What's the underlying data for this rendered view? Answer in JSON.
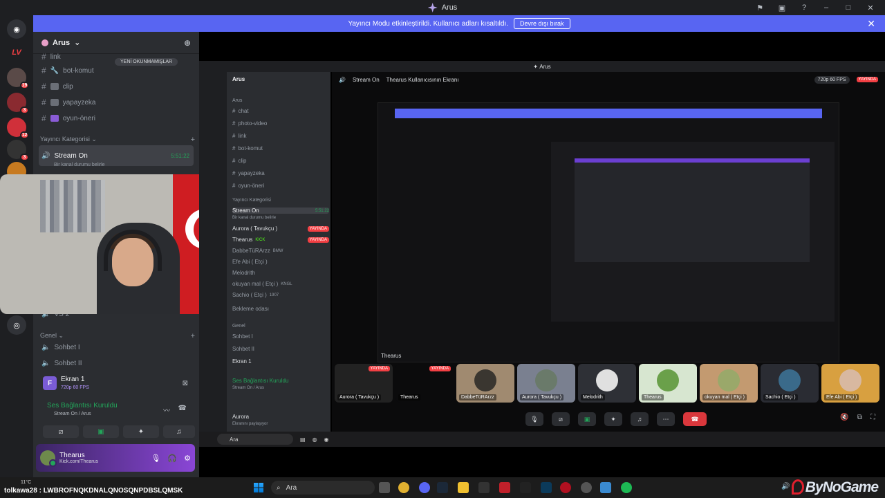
{
  "window": {
    "title": "Arus"
  },
  "banner": {
    "message": "Yayıncı Modu etkinleştirildi. Kullanıcı adları kısaltıldı.",
    "button": "Devre dışı bırak"
  },
  "rail": {
    "badges": [
      "19",
      "3",
      "12",
      "3"
    ],
    "logo_text": "LV"
  },
  "server": {
    "name": "Arus"
  },
  "unread_pill": "YENİ OKUNMAMIŞLAR",
  "channels": [
    "link",
    "bot-komut",
    "clip",
    "yapayzeka",
    "oyun-öneri"
  ],
  "category": "Yayıncı Kategorisi",
  "voice_channel": {
    "name": "Stream On",
    "time": "5:51:22",
    "status": "Bir kanal durumu belirle"
  },
  "genel": {
    "category": "Genel",
    "channels": [
      "Sohbet I",
      "Sohbet II"
    ]
  },
  "partial_channel": "VS 2",
  "voice_panel": {
    "screen": "Ekran 1",
    "quality": "720p 60 FPS",
    "connection": "Ses Bağlantısı Kuruldu",
    "connection_sub": "Stream On / Arus"
  },
  "user": {
    "name": "Thearus",
    "status": "Kick.com/Thearus"
  },
  "inner": {
    "title": "Arus",
    "server": "Arus",
    "category_label": "Arus",
    "channels": [
      "chat",
      "photo-video",
      "link",
      "bot-komut",
      "clip",
      "yapayzeka",
      "oyun-öneri"
    ],
    "category": "Yayıncı Kategorisi",
    "stream_channel": "Stream On",
    "stream_time": "5:51:22",
    "stream_status": "Bir kanal durumu belirle",
    "members": [
      {
        "name": "Aurora ( Tavukçu )",
        "live": "YAYINDA"
      },
      {
        "name": "Thearus",
        "tag": "KICK",
        "live": "YAYINDA"
      },
      {
        "name": "DabbeTüRArzz",
        "tag": "BMW"
      },
      {
        "name": "Efe Abi ( Etçi )"
      },
      {
        "name": "Melodrith"
      },
      {
        "name": "okuyan mal ( Etçi )",
        "tag": "KNGL"
      },
      {
        "name": "Sachio ( Etçi )",
        "tag": "1907"
      }
    ],
    "waiting_room": "Bekleme odası",
    "genel_category": "Genel",
    "genel_channels": [
      "Sohbet I",
      "Sohbet II"
    ],
    "voice_screen": "Ekran 1",
    "voice_connection": "Ses Bağlantısı Kuruldu",
    "voice_sub": "Stream On / Arus",
    "user_name": "Aurora",
    "user_status": "Ekranını paylaşıyor",
    "stage_title": "Stream On",
    "stage_viewer": "Thearus Kullanıcısının Ekranı",
    "quality": "720p 60 FPS",
    "live": "YAYINDA",
    "nested_label": "Thearus",
    "tiles": [
      {
        "name": "Aurora ( Tavukçu )",
        "live": "YAYINDA"
      },
      {
        "name": "Thearus",
        "live": "YAYINDA"
      },
      {
        "name": "DabbeTüRArzz"
      },
      {
        "name": "Aurora ( Tavukçu )"
      },
      {
        "name": "Melodrith"
      },
      {
        "name": "Thearus"
      },
      {
        "name": "okuyan mal ( Etçi )"
      },
      {
        "name": "Sachio ( Etçi )"
      },
      {
        "name": "Efe Abi ( Etçi )"
      }
    ],
    "search": "Ara"
  },
  "taskbar": {
    "weather": "11°C",
    "ticker": "tolkawa28 : LWBROFNQKDNALQNOSQNPDBSLQMSK",
    "search": "Ara",
    "brand": "ByNoGame"
  },
  "colors": {
    "accent": "#5865f2",
    "live": "#f23f43",
    "connected": "#23a55a"
  }
}
